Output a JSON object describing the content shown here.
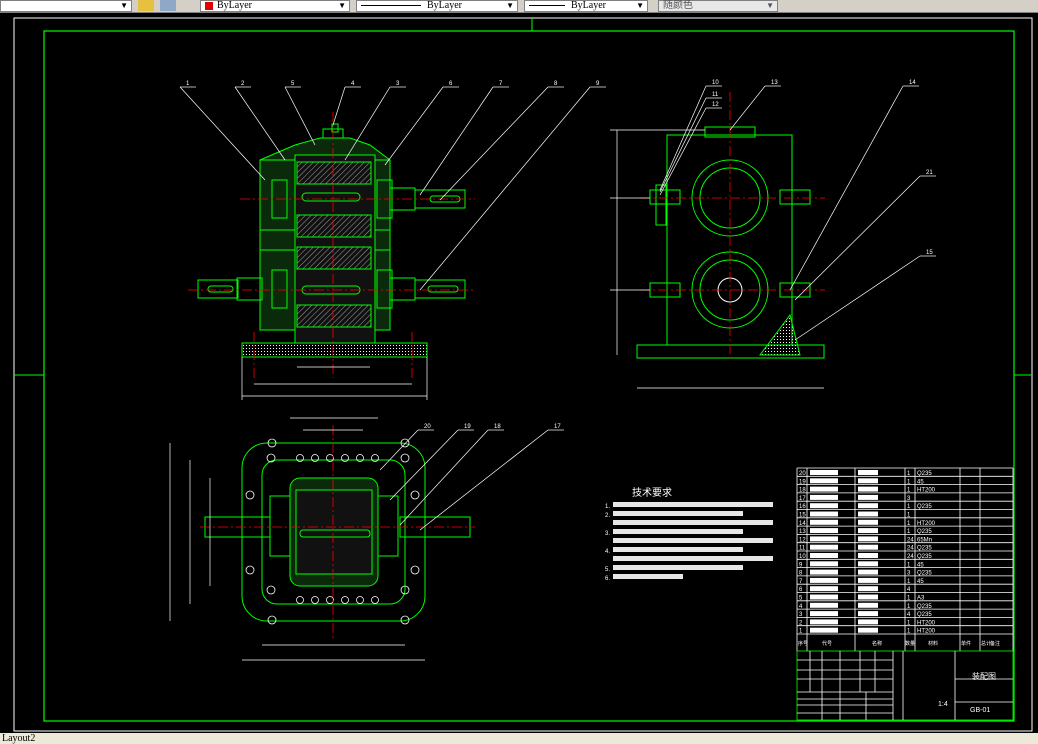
{
  "toolbar": {
    "layer_color": "ByLayer",
    "linetype": "ByLayer",
    "lineweight": "ByLayer",
    "plotstyle": "随颜色"
  },
  "colors": {
    "outline": "#00ff00",
    "centerline": "#ff0000",
    "annotation": "#ffffff",
    "background": "#000000",
    "color_swatch": "#e00000"
  },
  "drawing": {
    "front_view_balloons": [
      "1",
      "2",
      "5",
      "4",
      "3",
      "6",
      "7",
      "8",
      "9"
    ],
    "side_view_balloons": [
      "10",
      "11",
      "12",
      "13",
      "14",
      "21",
      "15"
    ],
    "plan_view_balloons": [
      "20",
      "19",
      "18",
      "17"
    ]
  },
  "tech_requirements": {
    "title": "技术要求",
    "lines": [
      "1.",
      "2.",
      "",
      "3.",
      "",
      "4.",
      "",
      "5.",
      "6."
    ]
  },
  "bom": {
    "rows": [
      "20",
      "19",
      "18",
      "17",
      "16",
      "15",
      "14",
      "13",
      "12",
      "11",
      "10",
      "9",
      "8",
      "7",
      "6",
      "5",
      "4",
      "3",
      "2",
      "1"
    ],
    "quantities": [
      "1",
      "1",
      "1",
      "3",
      "1",
      "1",
      "1",
      "1",
      "24",
      "24",
      "24",
      "1",
      "3",
      "1",
      "4",
      "1",
      "1",
      "4",
      "1",
      "1"
    ],
    "materials": [
      "Q235",
      "45",
      "HT200",
      "",
      "Q235",
      "",
      "HT200",
      "Q235",
      "65Mn",
      "Q235",
      "Q235",
      "45",
      "Q235",
      "45",
      "",
      "A3",
      "Q235",
      "Q235",
      "HT200",
      "HT200"
    ],
    "header": [
      "序号",
      "代号",
      "名称",
      "数量",
      "材料",
      "单件",
      "总计",
      "备注"
    ]
  },
  "title_block": {
    "name": "装配图",
    "drawing_no": "GB-01",
    "scale": "1:4"
  },
  "status": {
    "layout_tab": "Layout2"
  }
}
